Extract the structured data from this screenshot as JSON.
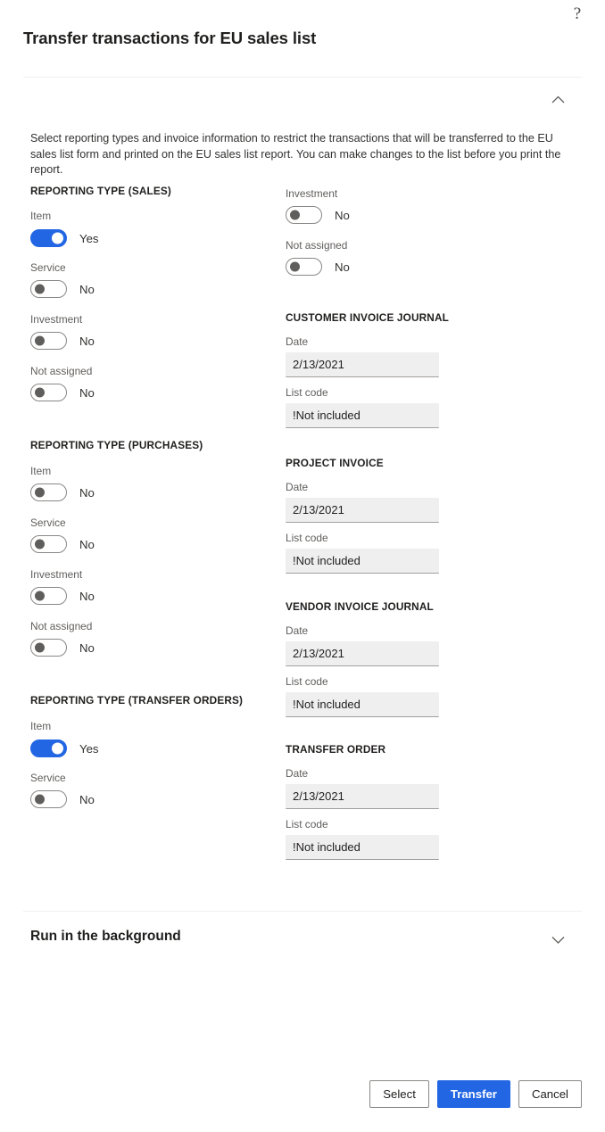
{
  "dialog": {
    "title": "Transfer transactions for EU sales list",
    "help_icon": "?",
    "description": "Select reporting types and invoice information to restrict the transactions that will be transferred to the EU sales list form and printed on the EU sales list report. You can make changes to the list before you print the report."
  },
  "left": {
    "sales": {
      "heading": "REPORTING TYPE (SALES)",
      "toggles": [
        {
          "label": "Item",
          "state": "on",
          "value": "Yes"
        },
        {
          "label": "Service",
          "state": "off",
          "value": "No"
        },
        {
          "label": "Investment",
          "state": "off",
          "value": "No"
        },
        {
          "label": "Not assigned",
          "state": "off",
          "value": "No"
        }
      ]
    },
    "purchases": {
      "heading": "REPORTING TYPE (PURCHASES)",
      "toggles": [
        {
          "label": "Item",
          "state": "off",
          "value": "No"
        },
        {
          "label": "Service",
          "state": "off",
          "value": "No"
        },
        {
          "label": "Investment",
          "state": "off",
          "value": "No"
        },
        {
          "label": "Not assigned",
          "state": "off",
          "value": "No"
        }
      ]
    },
    "transfer_orders": {
      "heading": "REPORTING TYPE (TRANSFER ORDERS)",
      "toggles": [
        {
          "label": "Item",
          "state": "on",
          "value": "Yes"
        },
        {
          "label": "Service",
          "state": "off",
          "value": "No"
        }
      ]
    }
  },
  "right": {
    "top_toggles": [
      {
        "label": "Investment",
        "state": "off",
        "value": "No"
      },
      {
        "label": "Not assigned",
        "state": "off",
        "value": "No"
      }
    ],
    "customer_invoice_journal": {
      "heading": "CUSTOMER INVOICE JOURNAL",
      "date_label": "Date",
      "date_value": "2/13/2021",
      "list_code_label": "List code",
      "list_code_value": "!Not included"
    },
    "project_invoice": {
      "heading": "PROJECT INVOICE",
      "date_label": "Date",
      "date_value": "2/13/2021",
      "list_code_label": "List code",
      "list_code_value": "!Not included"
    },
    "vendor_invoice_journal": {
      "heading": "VENDOR INVOICE JOURNAL",
      "date_label": "Date",
      "date_value": "2/13/2021",
      "list_code_label": "List code",
      "list_code_value": "!Not included"
    },
    "transfer_order": {
      "heading": "TRANSFER ORDER",
      "date_label": "Date",
      "date_value": "2/13/2021",
      "list_code_label": "List code",
      "list_code_value": "!Not included"
    }
  },
  "run_in_background": {
    "label": "Run in the background",
    "expanded": false
  },
  "footer": {
    "select_label": "Select",
    "transfer_label": "Transfer",
    "cancel_label": "Cancel"
  },
  "colors": {
    "accent": "#2266e3",
    "text": "#201f1e",
    "muted_text": "#605e5c",
    "input_bg": "#f0eff0",
    "divider": "#f0f0f0"
  }
}
